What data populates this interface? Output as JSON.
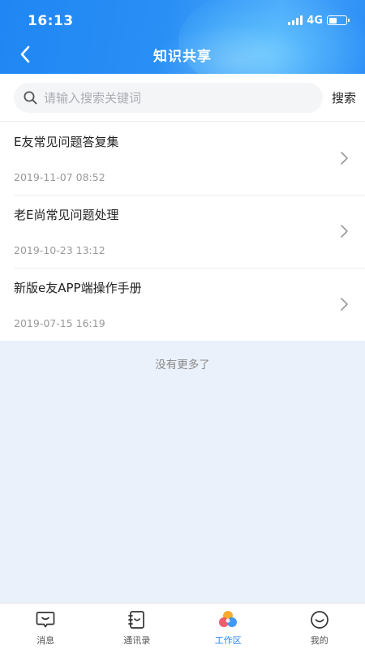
{
  "status_bar": {
    "time": "16:13",
    "network": "4G"
  },
  "header": {
    "title": "知识共享",
    "back_icon": "chevron-left-icon"
  },
  "search": {
    "placeholder": "请输入搜索关键词",
    "value": "",
    "button_label": "搜索",
    "icon": "search-icon"
  },
  "articles": [
    {
      "title": "E友常见问题答复集",
      "date": "2019-11-07 08:52"
    },
    {
      "title": "老E尚常见问题处理",
      "date": "2019-10-23 13:12"
    },
    {
      "title": "新版e友APP端操作手册",
      "date": "2019-07-15 16:19"
    }
  ],
  "list_footer": "没有更多了",
  "tabbar": {
    "tabs": [
      {
        "label": "消息",
        "icon": "message-icon",
        "active": false
      },
      {
        "label": "通讯录",
        "icon": "contacts-icon",
        "active": false
      },
      {
        "label": "工作区",
        "icon": "workspace-icon",
        "active": true
      },
      {
        "label": "我的",
        "icon": "profile-icon",
        "active": false
      }
    ]
  },
  "colors": {
    "accent": "#2a86f2",
    "page_background": "#ebf1fb"
  }
}
